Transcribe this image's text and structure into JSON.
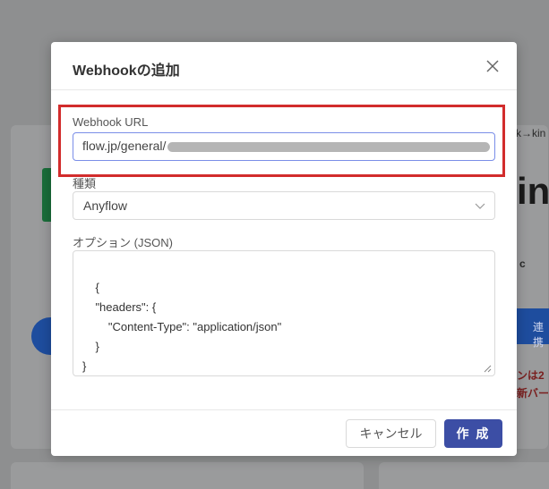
{
  "background": {
    "frag_arrow": "k→kin",
    "frag_big": "in",
    "frag_c": "c",
    "frag_connect": "連携",
    "frag_red1": "ンは2",
    "frag_red2": "新バー"
  },
  "modal": {
    "title": "Webhookの追加",
    "url_label": "Webhook URL",
    "url_value": "flow.jp/general/",
    "type_label": "種類",
    "type_value": "Anyflow",
    "options_label": "オプション (JSON)",
    "options_value": "{\n    \"headers\": {\n        \"Content-Type\": \"application/json\"\n    }\n}",
    "cancel_label": "キャンセル",
    "create_label": "作 成"
  },
  "colors": {
    "primary": "#3c4ea5",
    "highlight": "#d22c2c",
    "input_focus": "#7a8ee8"
  },
  "icons": {
    "close": "close-icon",
    "select": "chevron-down-icon"
  }
}
